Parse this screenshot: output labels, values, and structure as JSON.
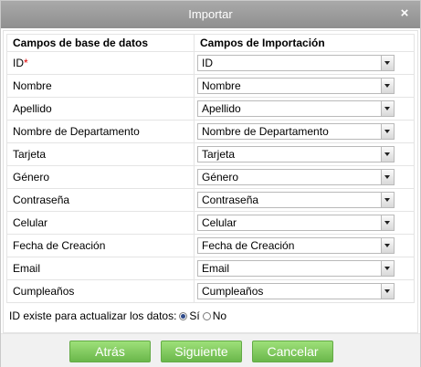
{
  "dialog": {
    "title": "Importar",
    "close_glyph": "×"
  },
  "table": {
    "header_db": "Campos de base de datos",
    "header_import": "Campos de Importación",
    "rows": [
      {
        "label": "ID",
        "required_mark": "*",
        "value": "ID"
      },
      {
        "label": "Nombre",
        "value": "Nombre"
      },
      {
        "label": "Apellido",
        "value": "Apellido"
      },
      {
        "label": "Nombre de Departamento",
        "value": "Nombre de Departamento"
      },
      {
        "label": "Tarjeta",
        "value": "Tarjeta"
      },
      {
        "label": "Género",
        "value": "Género"
      },
      {
        "label": "Contraseña",
        "value": "Contraseña"
      },
      {
        "label": "Celular",
        "value": "Celular"
      },
      {
        "label": "Fecha de Creación",
        "value": "Fecha de Creación"
      },
      {
        "label": "Email",
        "value": "Email"
      },
      {
        "label": "Cumpleaños",
        "value": "Cumpleaños"
      }
    ]
  },
  "update_option": {
    "label": "ID existe para actualizar los datos:",
    "yes": "Sí",
    "no": "No",
    "selected": "yes"
  },
  "buttons": {
    "back": "Atrás",
    "next": "Siguiente",
    "cancel": "Cancelar"
  },
  "colors": {
    "titlebar": "#9a9a9a",
    "button_green": "#7cc85a",
    "required": "#e00000"
  }
}
